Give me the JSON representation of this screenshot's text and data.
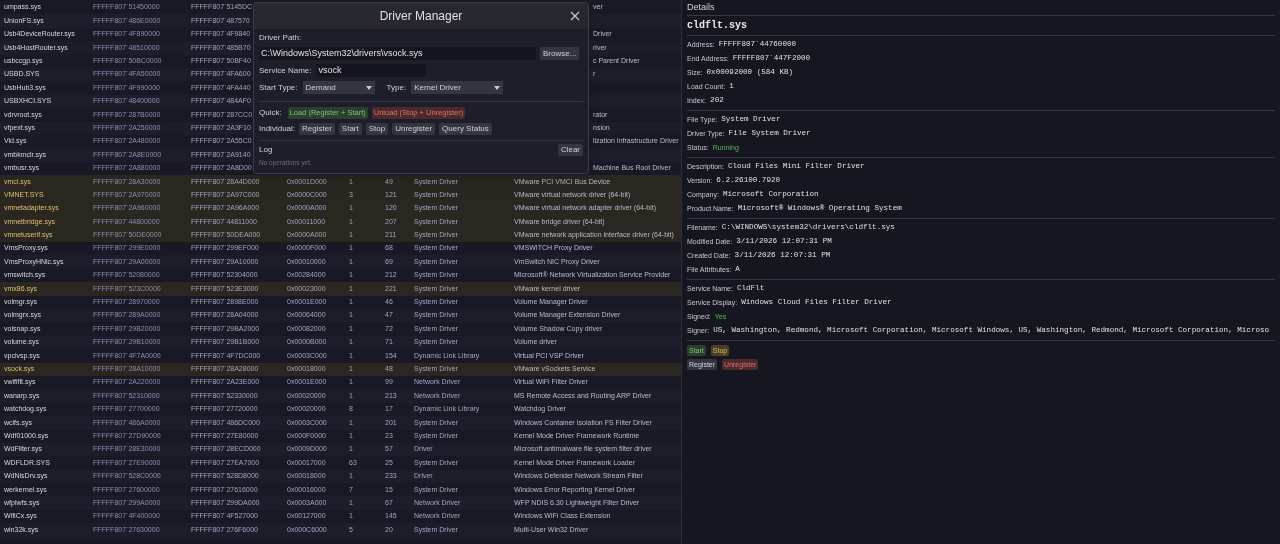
{
  "table": {
    "rows": [
      {
        "name": "umpass.sys",
        "address": "FFFFF807`51450000",
        "end_address": "FFFFF807`5145DC",
        "description": "ver",
        "highlighted": false
      },
      {
        "name": "UnionFS.sys",
        "address": "FFFFF807`486E0000",
        "end_address": "FFFFF807`487570",
        "highlighted": false
      },
      {
        "name": "Usb4DeviceRouter.sys",
        "address": "FFFFF807`4F890000",
        "end_address": "FFFFF807`4F9840",
        "description": "Driver",
        "highlighted": false
      },
      {
        "name": "Usb4HostRouter.sys",
        "address": "FFFFF807`48510000",
        "end_address": "FFFFF807`485B70",
        "description": "river",
        "highlighted": false
      },
      {
        "name": "usbccgp.sys",
        "address": "FFFFF807`50BC0000",
        "end_address": "FFFFF807`50BF40",
        "description": "c Parent Driver",
        "highlighted": false
      },
      {
        "name": "USBD.SYS",
        "address": "FFFFF807`4FA50000",
        "end_address": "FFFFF807`4FA600",
        "description": "r",
        "highlighted": false
      },
      {
        "name": "UsbHub3.sys",
        "address": "FFFFF807`4F990000",
        "end_address": "FFFFF807`4FA440",
        "highlighted": false
      },
      {
        "name": "USBXHCI.SYS",
        "address": "FFFFF807`48400000",
        "end_address": "FFFFF807`484AF0",
        "highlighted": false
      },
      {
        "name": "vdrvroot.sys",
        "address": "FFFFF807`287B0000",
        "end_address": "FFFFF807`287CC0",
        "description": "rator",
        "highlighted": false
      },
      {
        "name": "vfpext.sys",
        "address": "FFFFF807`2A250000",
        "end_address": "FFFFF807`2A3F10",
        "description": "nsion",
        "highlighted": false
      },
      {
        "name": "Vid.sys",
        "address": "FFFFF807`2A480000",
        "end_address": "FFFFF807`2A55C0",
        "description": "lization Infrastructure Driver",
        "highlighted": false
      },
      {
        "name": "vmbkmclr.sys",
        "address": "FFFFF807`2A8E0000",
        "end_address": "FFFFF807`2A9140",
        "highlighted": false
      },
      {
        "name": "vmbusr.sys",
        "address": "FFFFF807`2A880000",
        "end_address": "FFFFF807`2A8D00",
        "description": "Machine Bus Root Driver",
        "highlighted": false
      },
      {
        "name": "vmci.sys",
        "address": "FFFFF807`28A30000",
        "end_address": "FFFFF807`28A4D000",
        "size": "0x0001D000",
        "load_count": "1",
        "index": "49",
        "type": "System Driver",
        "description": "VMware PCI VMCI Bus Device",
        "highlighted": true
      },
      {
        "name": "VMNET.SYS",
        "address": "FFFFF807`2A970000",
        "end_address": "FFFFF807`2A97C000",
        "size": "0x0000C000",
        "load_count": "3",
        "index": "121",
        "type": "System Driver",
        "description": "VMware virtual network driver (64-bit)",
        "highlighted": true
      },
      {
        "name": "vmnetadapter.sys",
        "address": "FFFFF807`2A960000",
        "end_address": "FFFFF807`2A96A000",
        "size": "0x0000A000",
        "load_count": "1",
        "index": "120",
        "type": "System Driver",
        "description": "VMware virtual network adapter driver (64-bit)",
        "highlighted": true
      },
      {
        "name": "vmnetbridge.sys",
        "address": "FFFFF807`44800000",
        "end_address": "FFFFF807`44811000",
        "size": "0x00011000",
        "load_count": "1",
        "index": "207",
        "type": "System Driver",
        "description": "VMware bridge driver (64-bit)",
        "highlighted": true
      },
      {
        "name": "vmnetuserif.sys",
        "address": "FFFFF807`50DE0000",
        "end_address": "FFFFF807`50DEA000",
        "size": "0x0000A000",
        "load_count": "1",
        "index": "211",
        "type": "System Driver",
        "description": "VMware network application interface driver (64-bit)",
        "highlighted": true
      },
      {
        "name": "VmsProxy.sys",
        "address": "FFFFF807`299E0000",
        "end_address": "FFFFF807`299EF000",
        "size": "0x0000F000",
        "load_count": "1",
        "index": "68",
        "type": "System Driver",
        "description": "VMSWITCH Proxy Driver",
        "highlighted": false
      },
      {
        "name": "VmsProxyHNic.sys",
        "address": "FFFFF807`29A00000",
        "end_address": "FFFFF807`29A10000",
        "size": "0x00010000",
        "load_count": "1",
        "index": "69",
        "type": "System Driver",
        "description": "VmSwitch NIC Proxy Driver",
        "highlighted": false
      },
      {
        "name": "vmswitch.sys",
        "address": "FFFFF807`52080000",
        "end_address": "FFFFF807`52304000",
        "size": "0x00284000",
        "load_count": "1",
        "index": "212",
        "type": "System Driver",
        "description": "Microsoft® Network Virtualization Service Provider",
        "highlighted": false
      },
      {
        "name": "vmx86.sys",
        "address": "FFFFF807`523C0000",
        "end_address": "FFFFF807`523E3000",
        "size": "0x00023000",
        "load_count": "1",
        "index": "221",
        "type": "System Driver",
        "description": "VMware kernel driver",
        "highlighted": true
      },
      {
        "name": "volmgr.sys",
        "address": "FFFFF807`28970000",
        "end_address": "FFFFF807`2898E000",
        "size": "0x0001E000",
        "load_count": "1",
        "index": "46",
        "type": "System Driver",
        "description": "Volume Manager Driver",
        "highlighted": false
      },
      {
        "name": "volmgrx.sys",
        "address": "FFFFF807`289A0000",
        "end_address": "FFFFF807`28A04000",
        "size": "0x00064000",
        "load_count": "1",
        "index": "47",
        "type": "System Driver",
        "description": "Volume Manager Extension Driver",
        "highlighted": false
      },
      {
        "name": "volsnap.sys",
        "address": "FFFFF807`29B20000",
        "end_address": "FFFFF807`29BA2000",
        "size": "0x00082000",
        "load_count": "1",
        "index": "72",
        "type": "System Driver",
        "description": "Volume Shadow Copy driver",
        "highlighted": false
      },
      {
        "name": "volume.sys",
        "address": "FFFFF807`29B10000",
        "end_address": "FFFFF807`29B1B000",
        "size": "0x0000B000",
        "load_count": "1",
        "index": "71",
        "type": "System Driver",
        "description": "Volume driver",
        "highlighted": false
      },
      {
        "name": "vpcivsp.sys",
        "address": "FFFFF807`4F7A0000",
        "end_address": "FFFFF807`4F7DC000",
        "size": "0x0003C000",
        "load_count": "1",
        "index": "154",
        "type": "Dynamic Link Library",
        "description": "Virtual PCI VSP Driver",
        "highlighted": false
      },
      {
        "name": "vsock.sys",
        "address": "FFFFF807`28A10000",
        "end_address": "FFFFF807`28A28000",
        "size": "0x00018000",
        "load_count": "1",
        "index": "48",
        "type": "System Driver",
        "description": "VMware vSockets Service",
        "highlighted": true
      },
      {
        "name": "vwififlt.sys",
        "address": "FFFFF807`2A220000",
        "end_address": "FFFFF807`2A23E000",
        "size": "0x0001E000",
        "load_count": "1",
        "index": "99",
        "type": "Network Driver",
        "description": "Virtual WiFi Filter Driver",
        "highlighted": false
      },
      {
        "name": "wanarp.sys",
        "address": "FFFFF807`52310000",
        "end_address": "FFFFF807`52330000",
        "size": "0x00020000",
        "load_count": "1",
        "index": "213",
        "type": "Network Driver",
        "description": "MS Remote Access and Routing ARP Driver",
        "highlighted": false
      },
      {
        "name": "watchdog.sys",
        "address": "FFFFF807`27700000",
        "end_address": "FFFFF807`27720000",
        "size": "0x00020000",
        "load_count": "8",
        "index": "17",
        "type": "Dynamic Link Library",
        "description": "Watchdog Driver",
        "highlighted": false
      },
      {
        "name": "wcifs.sys",
        "address": "FFFFF807`486A0000",
        "end_address": "FFFFF807`486DC000",
        "size": "0x0003C000",
        "load_count": "1",
        "index": "201",
        "type": "System Driver",
        "description": "Windows Container Isolation FS Filter Driver",
        "highlighted": false
      },
      {
        "name": "Wdf01000.sys",
        "address": "FFFFF807`27D90000",
        "end_address": "FFFFF807`27E80000",
        "size": "0x000F0000",
        "load_count": "1",
        "index": "23",
        "type": "System Driver",
        "description": "Kernel Mode Driver Framework Runtime",
        "highlighted": false
      },
      {
        "name": "WdFilter.sys",
        "address": "FFFFF807`28E30000",
        "end_address": "FFFFF807`28ECD000",
        "size": "0x0009D000",
        "load_count": "1",
        "index": "57",
        "type": "Driver",
        "description": "Microsoft antimalware file system filter driver",
        "highlighted": false
      },
      {
        "name": "WDFLDR.SYS",
        "address": "FFFFF807`27E90000",
        "end_address": "FFFFF807`27EA7000",
        "size": "0x00017000",
        "load_count": "63",
        "index": "25",
        "type": "System Driver",
        "description": "Kernel Mode Driver Framework Loader",
        "highlighted": false
      },
      {
        "name": "WdNisDrv.sys",
        "address": "FFFFF807`528C0000",
        "end_address": "FFFFF807`528D8000",
        "size": "0x00018000",
        "load_count": "1",
        "index": "233",
        "type": "Driver",
        "description": "Windows Defender Network Stream Filter",
        "highlighted": false
      },
      {
        "name": "werkernel.sys",
        "address": "FFFFF807`27600000",
        "end_address": "FFFFF807`27616000",
        "size": "0x00016000",
        "load_count": "7",
        "index": "15",
        "type": "System Driver",
        "description": "Windows Error Reporting Kernel Driver",
        "highlighted": false
      },
      {
        "name": "wfplwfs.sys",
        "address": "FFFFF807`299A0000",
        "end_address": "FFFFF807`299DA000",
        "size": "0x0003A000",
        "load_count": "1",
        "index": "67",
        "type": "Network Driver",
        "description": "WFP NDIS 6.30 Lightweight Filter Driver",
        "highlighted": false
      },
      {
        "name": "WifiCx.sys",
        "address": "FFFFF807`4F400000",
        "end_address": "FFFFF807`4F527000",
        "size": "0x00127000",
        "load_count": "1",
        "index": "145",
        "type": "Network Driver",
        "description": "Windows WiFi Class Extension",
        "highlighted": false
      },
      {
        "name": "win32k.sys",
        "address": "FFFFF807`27630000",
        "end_address": "FFFFF807`276F6000",
        "size": "0x000C6000",
        "load_count": "5",
        "index": "20",
        "type": "System Driver",
        "description": "Multi-User Win32 Driver",
        "highlighted": false
      }
    ]
  },
  "dialog": {
    "title": "Driver Manager",
    "driver_path_label": "Driver Path:",
    "driver_path": "C:\\Windows\\System32\\drivers\\vsock.sys",
    "browse": "Browse...",
    "service_name_label": "Service Name:",
    "service_name": "vsock",
    "start_type_label": "Start Type:",
    "start_type": "Demand",
    "type_label": "Type:",
    "type": "Kernel Driver",
    "quick_label": "Quick:",
    "quick_buttons": [
      {
        "label": "Load (Register + Start)",
        "kind": "success"
      },
      {
        "label": "Unload (Stop + Unregister)",
        "kind": "danger"
      }
    ],
    "individual_label": "Individual:",
    "individual_buttons": [
      {
        "label": "Register",
        "kind": "neutral"
      },
      {
        "label": "Start",
        "kind": "neutral"
      },
      {
        "label": "Stop",
        "kind": "neutral"
      },
      {
        "label": "Unregister",
        "kind": "neutral"
      },
      {
        "label": "Query Status",
        "kind": "neutral"
      }
    ],
    "log_label": "Log",
    "clear": "Clear",
    "log_placeholder": "No operations yet."
  },
  "details": {
    "header": "Details",
    "file": "cldflt.sys",
    "sections": [
      [
        {
          "label": "Address:",
          "value": "FFFFF807`44760000",
          "kind": "text"
        },
        {
          "label": "End Address:",
          "value": "FFFFF807`447F2000",
          "kind": "text"
        },
        {
          "label": "Size:",
          "value": "0x00092000 (584 KB)",
          "kind": "text"
        },
        {
          "label": "Load Count:",
          "value": "1",
          "kind": "text"
        },
        {
          "label": "Index:",
          "value": "202",
          "kind": "text"
        }
      ],
      [
        {
          "label": "File Type:",
          "value": "System Driver",
          "kind": "text"
        },
        {
          "label": "Driver Type:",
          "value": "File System Driver",
          "kind": "text"
        },
        {
          "label": "Status:",
          "value": "Running",
          "kind": "status"
        }
      ],
      [
        {
          "label": "Description:",
          "value": "Cloud Files Mini Filter Driver",
          "kind": "text"
        },
        {
          "label": "Version:",
          "value": "6.2.26100.7920",
          "kind": "text"
        },
        {
          "label": "Company:",
          "value": "Microsoft Corporation",
          "kind": "text"
        },
        {
          "label": "Product Name:",
          "value": "Microsoft® Windows® Operating System",
          "kind": "text"
        }
      ],
      [
        {
          "label": "Filename:",
          "value": "C:\\WINDOWS\\system32\\drivers\\cldflt.sys",
          "kind": "text"
        },
        {
          "label": "Modified Date:",
          "value": "3/11/2026 12:07:31 PM",
          "kind": "text"
        },
        {
          "label": "Created Date:",
          "value": "3/11/2026 12:07:31 PM",
          "kind": "text"
        },
        {
          "label": "File Attributes:",
          "value": "A",
          "kind": "text"
        }
      ],
      [
        {
          "label": "Service Name:",
          "value": "CldFlt",
          "kind": "text"
        },
        {
          "label": "Service Display:",
          "value": "Windows Cloud Files Filter Driver",
          "kind": "text"
        },
        {
          "label": "Signed:",
          "value": "Yes",
          "kind": "status"
        },
        {
          "label": "Signer:",
          "value": "US, Washington, Redmond, Microsoft Corporation, Microsoft Windows, US, Washington, Redmond, Microsoft Corporation, Microso",
          "kind": "text"
        }
      ]
    ],
    "button_rows": [
      [
        {
          "label": "Start",
          "kind": "success"
        },
        {
          "label": "Stop",
          "kind": "warning"
        }
      ],
      [
        {
          "label": "Register",
          "kind": "neutral"
        },
        {
          "label": "Unregister",
          "kind": "danger"
        }
      ]
    ]
  }
}
